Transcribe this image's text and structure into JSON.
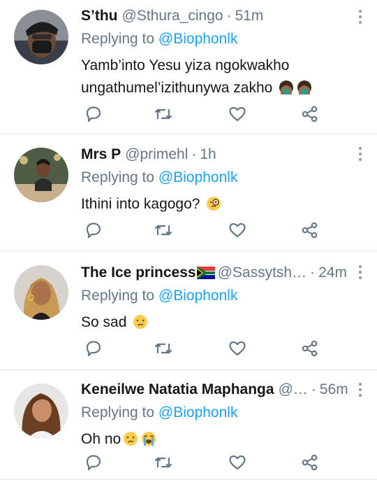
{
  "replies": [
    {
      "name": "S’thu",
      "handle": "@Sthura_cingo",
      "time": "51m",
      "replying_prefix": "Replying to ",
      "replying_to": "@Biophonlk",
      "text_line1": "Yamb’into Yesu yiza ngokwakho",
      "text_line2": "ungathumel’izithunywa zakho",
      "emojis": [
        "face-palm-emoji",
        "face-palm-emoji"
      ]
    },
    {
      "name": "Mrs P",
      "handle": "@primehl",
      "time": "1h",
      "replying_prefix": "Replying to ",
      "replying_to": "@Biophonlk",
      "text_line1": "Ithini into kagogo?",
      "emojis": [
        "monocle-face-emoji"
      ]
    },
    {
      "name": "The Ice princess",
      "handle": "@Sassytsh…",
      "time": "24m",
      "replying_prefix": "Replying to ",
      "replying_to": "@Biophonlk",
      "text_line1": "So sad",
      "emojis": [
        "crying-face-emoji"
      ]
    },
    {
      "name": "Keneilwe Natatia Maphanga",
      "handle": "@…",
      "time": "56m",
      "replying_prefix": "Replying to ",
      "replying_to": "@Biophonlk",
      "text_line1": "Oh no",
      "emojis": [
        "crying-face-emoji",
        "loudly-crying-face-emoji"
      ]
    }
  ],
  "colors": {
    "link": "#1da1f2",
    "secondary_text": "#657786",
    "icon": "#657786",
    "divider": "#e1e8ed"
  }
}
